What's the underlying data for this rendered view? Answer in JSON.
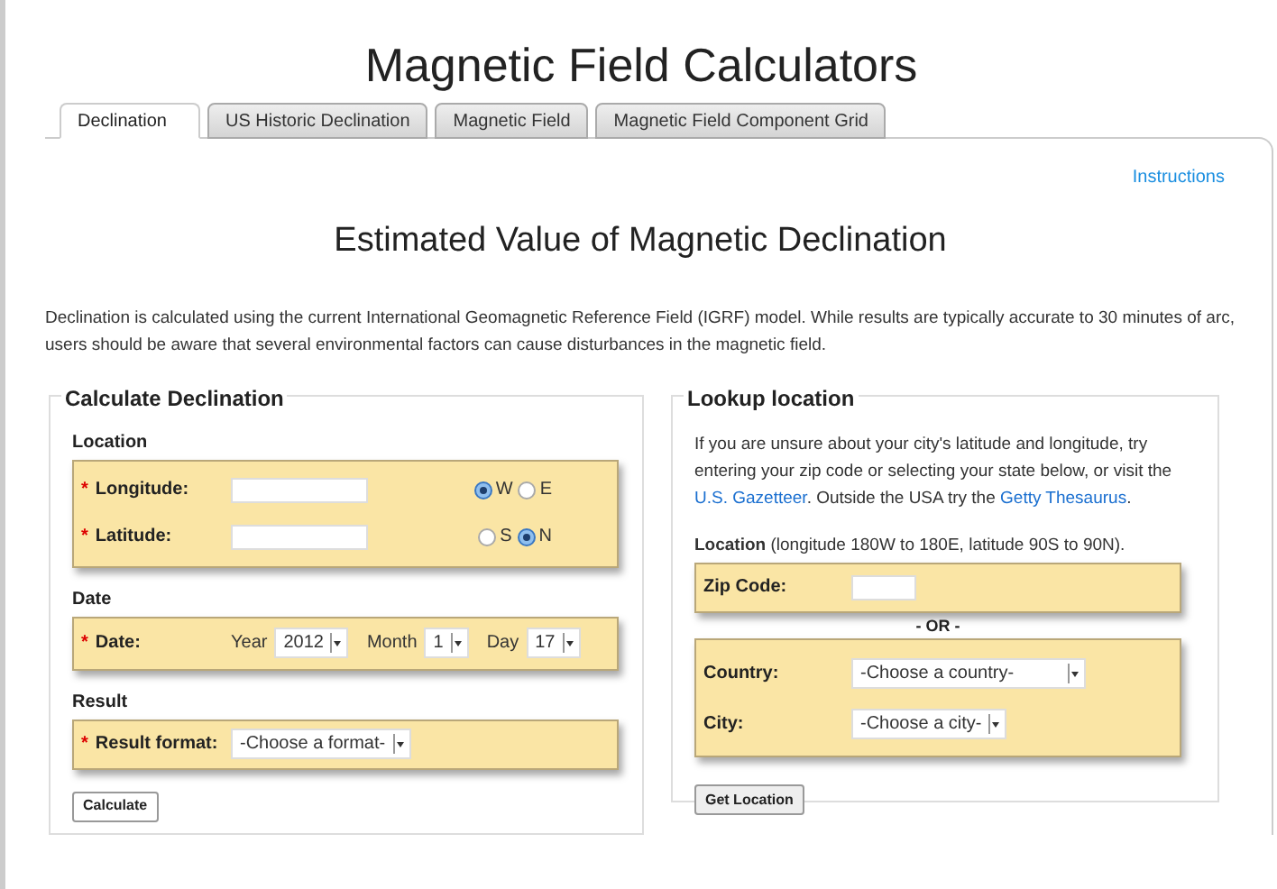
{
  "title": "Magnetic Field Calculators",
  "tabs": [
    {
      "label": "Declination",
      "selected": true
    },
    {
      "label": "US Historic Declination",
      "selected": false
    },
    {
      "label": "Magnetic Field",
      "selected": false
    },
    {
      "label": "Magnetic Field Component Grid",
      "selected": false
    }
  ],
  "instructions_link": "Instructions",
  "heading": "Estimated Value of Magnetic Declination",
  "intro": "Declination is calculated using the current International Geomagnetic Reference Field (IGRF) model. While results are typically accurate to 30 minutes of arc, users should be aware that several environmental factors can cause disturbances in the magnetic field.",
  "calculate": {
    "legend": "Calculate Declination",
    "location": {
      "label": "Location",
      "fields": [
        {
          "label": "Longitude:",
          "required_mark": "*",
          "options": [
            {
              "label": "W",
              "selected": true
            },
            {
              "label": "E",
              "selected": false
            }
          ]
        },
        {
          "label": "Latitude:",
          "required_mark": "*",
          "options": [
            {
              "label": "S",
              "selected": false
            },
            {
              "label": "N",
              "selected": true
            }
          ]
        }
      ]
    },
    "date": {
      "label": "Date",
      "field": {
        "label": "Date:",
        "required_mark": "*",
        "parts": [
          {
            "label": "Year",
            "value": "2012"
          },
          {
            "label": "Month",
            "value": "1"
          },
          {
            "label": "Day",
            "value": "17"
          }
        ]
      }
    },
    "result": {
      "label": "Result",
      "field": {
        "label": "Result format:",
        "required_mark": "*",
        "value": "-Choose a format-"
      }
    },
    "button": "Calculate"
  },
  "lookup": {
    "legend": "Lookup location",
    "text_before": "If you are unsure about your city's latitude and longitude, try entering your zip code or selecting your state below, or visit the",
    "link_1": "U.S. Gazetteer",
    "text_middle": ". Outside the USA try the",
    "link_2": "Getty Thesaurus",
    "text_after": ".",
    "location_label": "Location",
    "location_hint": "(longitude 180W to 180E, latitude 90S to 90N).",
    "zip_label": "Zip Code:",
    "separator": "- OR -",
    "country": {
      "label": "Country:",
      "value": "-Choose a country-"
    },
    "city": {
      "label": "City:",
      "value": "-Choose a city-"
    },
    "button": "Get Location"
  }
}
